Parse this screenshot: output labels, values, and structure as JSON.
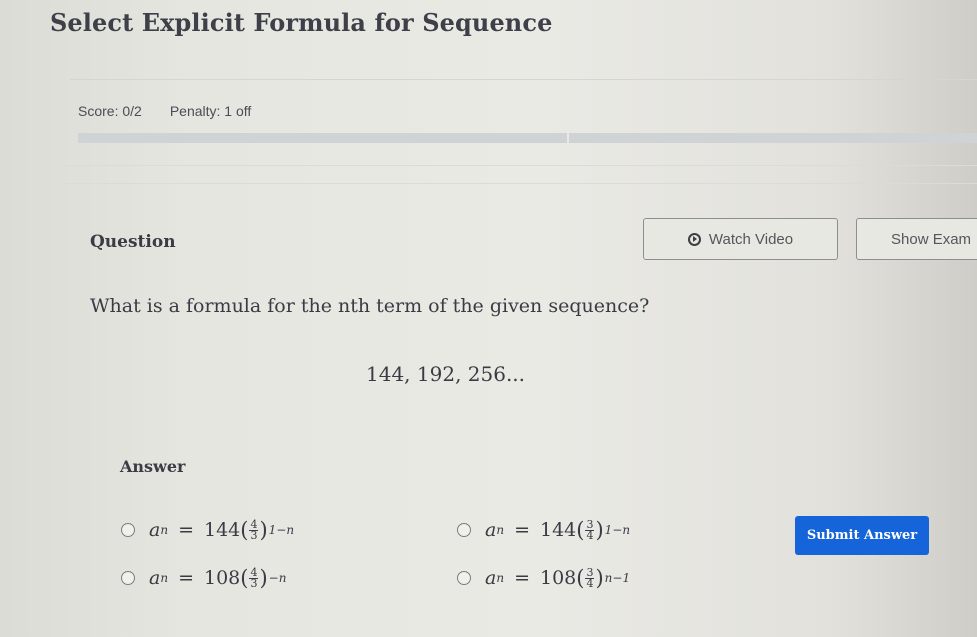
{
  "page": {
    "title": "Select Explicit Formula for Sequence"
  },
  "status": {
    "score": "Score: 0/2",
    "penalty": "Penalty: 1 off",
    "progress": {
      "total_questions": 2,
      "completed": 0
    }
  },
  "question": {
    "label": "Question",
    "text": "What is a formula for the nth term of the given sequence?",
    "sequence": "144, 192, 256...",
    "buttons": {
      "watch_video": "Watch Video",
      "show_example": "Show Exam"
    }
  },
  "answer": {
    "label": "Answer",
    "options": [
      {
        "var": "a",
        "sub": "n",
        "eq": "=",
        "coef": "144",
        "num": "4",
        "den": "3",
        "exp": "1−n",
        "selected": false
      },
      {
        "var": "a",
        "sub": "n",
        "eq": "=",
        "coef": "144",
        "num": "3",
        "den": "4",
        "exp": "1−n",
        "selected": false
      },
      {
        "var": "a",
        "sub": "n",
        "eq": "=",
        "coef": "108",
        "num": "4",
        "den": "3",
        "exp": "−n",
        "selected": false
      },
      {
        "var": "a",
        "sub": "n",
        "eq": "=",
        "coef": "108",
        "num": "3",
        "den": "4",
        "exp": "n−1",
        "selected": false
      }
    ],
    "submit_label": "Submit Answer"
  },
  "colors": {
    "submit_bg": "#1664d9",
    "progress_track": "#cfd3d5"
  },
  "icons": {
    "watch_video": "play-circle-icon"
  }
}
